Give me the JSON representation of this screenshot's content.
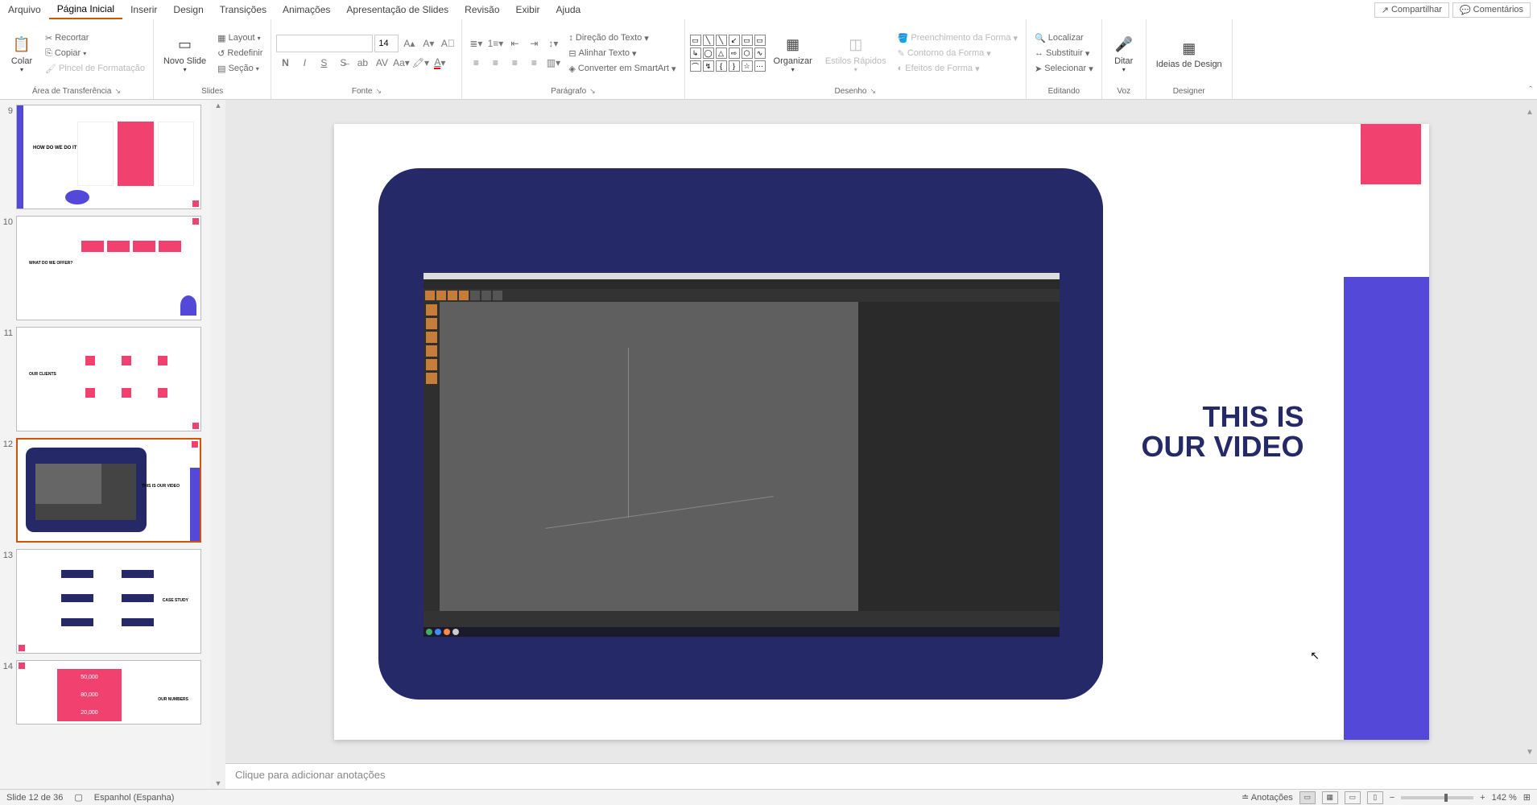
{
  "menu": {
    "tabs": [
      "Arquivo",
      "Página Inicial",
      "Inserir",
      "Design",
      "Transições",
      "Animações",
      "Apresentação de Slides",
      "Revisão",
      "Exibir",
      "Ajuda"
    ],
    "active_index": 1,
    "share": "Compartilhar",
    "comments": "Comentários"
  },
  "ribbon": {
    "clipboard": {
      "label": "Área de Transferência",
      "paste": "Colar",
      "cut": "Recortar",
      "copy": "Copiar",
      "format_painter": "Pincel de Formatação"
    },
    "slides": {
      "label": "Slides",
      "new_slide": "Novo Slide",
      "layout": "Layout",
      "reset": "Redefinir",
      "section": "Seção"
    },
    "font": {
      "label": "Fonte",
      "font_name": "",
      "font_size": "14"
    },
    "paragraph": {
      "label": "Parágrafo",
      "text_direction": "Direção do Texto",
      "align_text": "Alinhar Texto",
      "convert_smartart": "Converter em SmartArt"
    },
    "drawing": {
      "label": "Desenho",
      "arrange": "Organizar",
      "quick_styles": "Estilos Rápidos",
      "shape_fill": "Preenchimento da Forma",
      "shape_outline": "Contorno da Forma",
      "shape_effects": "Efeitos de Forma"
    },
    "editing": {
      "label": "Editando",
      "find": "Localizar",
      "replace": "Substituir",
      "select": "Selecionar"
    },
    "voice": {
      "label": "Voz",
      "dictate": "Ditar"
    },
    "designer": {
      "label": "Designer",
      "design_ideas": "Ideias de Design"
    }
  },
  "thumbnails": {
    "items": [
      {
        "num": "9",
        "label": "HOW DO WE DO IT?"
      },
      {
        "num": "10",
        "label": "WHAT DO WE OFFER?"
      },
      {
        "num": "11",
        "label": "OUR CLIENTS"
      },
      {
        "num": "12",
        "label": "THIS IS OUR VIDEO"
      },
      {
        "num": "13",
        "label": "CASE STUDY"
      },
      {
        "num": "14",
        "label": "OUR NUMBERS"
      }
    ],
    "active_index": 3
  },
  "slide": {
    "title_line1": "THIS IS",
    "title_line2": "OUR VIDEO"
  },
  "notes_placeholder": "Clique para adicionar anotações",
  "status": {
    "slide_info": "Slide 12 de 36",
    "language": "Espanhol (Espanha)",
    "notes_btn": "Anotações",
    "zoom": "142 %"
  },
  "thumb14": {
    "n1": "50,000",
    "n2": "80,000",
    "n3": "20,000"
  }
}
